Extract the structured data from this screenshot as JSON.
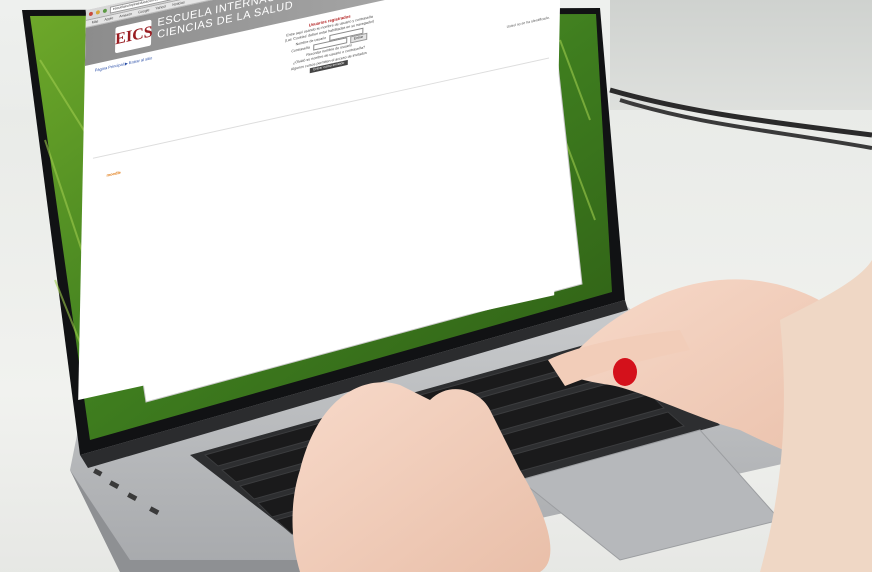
{
  "browser": {
    "url": "escuelaeuropeaeducacion.es",
    "bookmarks": [
      "Más",
      "Apple",
      "Amazon",
      "Google",
      "Yahoo!",
      "Noticias"
    ]
  },
  "site": {
    "logo": "EICS",
    "name_line1": "ESCUELA INTERNACIONAL DE",
    "name_line2": "CIENCIAS DE LA SALUD"
  },
  "page": {
    "breadcrumb": "Página Principal ▶ Entrar al sitio",
    "login_title": "Usuarios registrados",
    "intro_text": "Entre aquí usando su nombre de usuario y contraseña",
    "cookies_text": "(Las 'Cookies' deben estar habilitadas en su navegador)",
    "username_label": "Nombre de usuario",
    "password_label": "Contraseña",
    "login_button": "Entrar",
    "remember_text": "Recordar nombre de usuario",
    "forgot_text": "¿Olvidó su nombre de usuario o contraseña?",
    "guest_text": "Algunos cursos permiten el acceso de invitados",
    "guest_button": "Entrar como invitado",
    "right_note": "Usted no se ha identificado.",
    "footer_brand": "moodle"
  },
  "colors": {
    "header_gray": "#9a9a9a",
    "brand_red": "#9a1d22",
    "nail_red": "#d4111b",
    "moodle_orange": "#e27f1c"
  }
}
